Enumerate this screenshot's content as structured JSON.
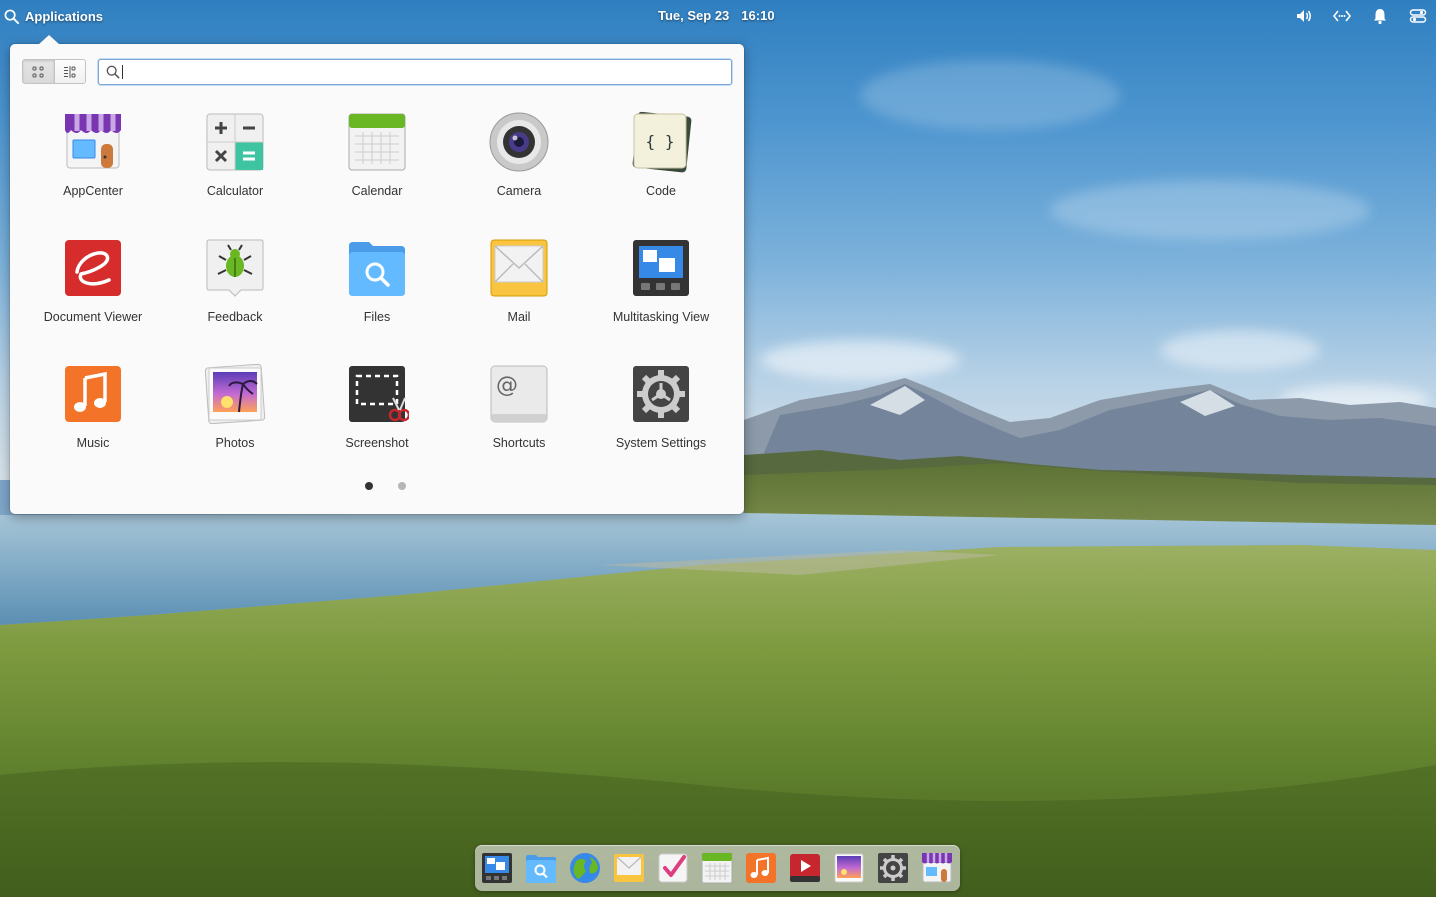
{
  "panel": {
    "applications_label": "Applications",
    "date": "Tue, Sep 23",
    "time": "16:10",
    "indicators": [
      "volume-icon",
      "network-icon",
      "notifications-icon",
      "session-icon"
    ]
  },
  "launcher": {
    "view_modes": [
      "grid-view",
      "category-view"
    ],
    "active_view": "grid-view",
    "search": {
      "value": "",
      "placeholder": ""
    },
    "apps": [
      {
        "label": "AppCenter",
        "icon": "appcenter-icon"
      },
      {
        "label": "Calculator",
        "icon": "calculator-icon"
      },
      {
        "label": "Calendar",
        "icon": "calendar-icon"
      },
      {
        "label": "Camera",
        "icon": "camera-icon"
      },
      {
        "label": "Code",
        "icon": "code-icon"
      },
      {
        "label": "Document Viewer",
        "icon": "document-viewer-icon"
      },
      {
        "label": "Feedback",
        "icon": "feedback-icon"
      },
      {
        "label": "Files",
        "icon": "files-icon"
      },
      {
        "label": "Mail",
        "icon": "mail-icon"
      },
      {
        "label": "Multitasking View",
        "icon": "multitasking-view-icon"
      },
      {
        "label": "Music",
        "icon": "music-icon"
      },
      {
        "label": "Photos",
        "icon": "photos-icon"
      },
      {
        "label": "Screenshot",
        "icon": "screenshot-icon"
      },
      {
        "label": "Shortcuts",
        "icon": "shortcuts-icon"
      },
      {
        "label": "System Settings",
        "icon": "system-settings-icon"
      }
    ],
    "pages": 2,
    "current_page": 1
  },
  "dock": {
    "items": [
      "multitasking-view-icon",
      "files-icon",
      "web-browser-icon",
      "mail-icon",
      "tasks-icon",
      "calendar-icon",
      "music-icon",
      "videos-icon",
      "photos-icon",
      "system-settings-icon",
      "appcenter-icon"
    ]
  },
  "colors": {
    "accent": "#3689e6",
    "panel_text": "#ffffff",
    "popover_bg": "#fafafa"
  }
}
